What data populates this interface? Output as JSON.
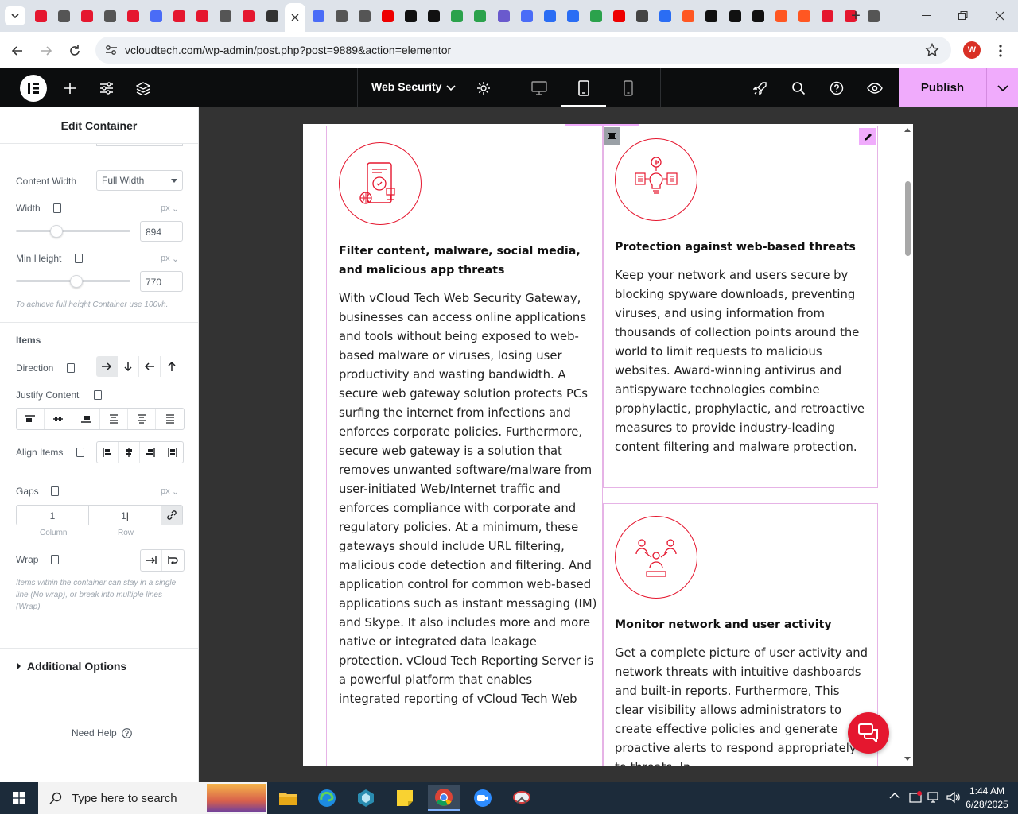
{
  "browser": {
    "url": "vcloudtech.com/wp-admin/post.php?post=9889&action=elementor",
    "profile_initial": "W",
    "tab_count": 37
  },
  "editor": {
    "document_title": "Web Security",
    "publish_label": "Publish"
  },
  "panel": {
    "title": "Edit Container",
    "content_width": {
      "label": "Content Width",
      "value": "Full Width"
    },
    "width": {
      "label": "Width",
      "unit": "px",
      "value": "894"
    },
    "min_height": {
      "label": "Min Height",
      "unit": "px",
      "value": "770"
    },
    "min_height_hint": "To achieve full height Container use 100vh.",
    "items_heading": "Items",
    "direction_label": "Direction",
    "justify_label": "Justify Content",
    "align_label": "Align Items",
    "gaps": {
      "label": "Gaps",
      "unit": "px",
      "column": "1",
      "row": "1",
      "column_label": "Column",
      "row_label": "Row"
    },
    "wrap_label": "Wrap",
    "wrap_hint": "Items within the container can stay in a single line (No wrap), or break into multiple lines (Wrap).",
    "additional_options": "Additional Options",
    "need_help": "Need Help"
  },
  "content": {
    "card1": {
      "title": "Filter content, malware, social media, and malicious app threats",
      "text": "With vCloud Tech Web Security Gateway, businesses can access online applications and tools without being exposed to web-based malware or viruses, losing user productivity and wasting bandwidth. A secure web gateway solution protects PCs surfing the internet from infections and enforces corporate policies. Furthermore, secure web gateway is a solution that removes unwanted software/malware from user-initiated Web/Internet traffic and enforces compliance with corporate and regulatory policies. At a minimum, these gateways should include URL filtering, malicious code detection and filtering. And application control for common web-based applications such as instant messaging (IM) and Skype. It also includes more and more native or integrated data leakage protection. vCloud Tech Reporting Server is a powerful platform that enables integrated reporting of vCloud Tech Web"
    },
    "card2": {
      "title": "Protection against web-based threats",
      "text": "Keep your network and users secure by blocking spyware downloads, preventing viruses, and using information from thousands of collection points around the world to limit requests to malicious websites. Award-winning antivirus and antispyware technologies combine prophylactic, prophylactic, and retroactive measures to provide industry-leading content filtering and malware protection."
    },
    "card3": {
      "title": "Monitor network and user activity",
      "text": "Get a complete picture of user activity and network threats with intuitive dashboards and built-in reports. Furthermore, This clear visibility allows administrators to create effective policies and generate proactive alerts to respond appropriately to threats. In"
    }
  },
  "taskbar": {
    "search_placeholder": "Type here to search",
    "time": "1:44 AM",
    "date": "6/28/2025"
  },
  "colors": {
    "accent": "#e5172f",
    "publish": "#f0abfc",
    "editor_bar": "#0c0d0e"
  }
}
